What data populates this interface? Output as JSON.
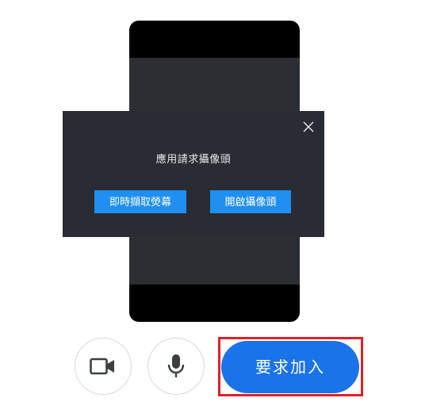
{
  "dialog": {
    "title": "應用請求攝像頭",
    "share_screen_label": "即時擷取熒幕",
    "open_camera_label": "開啟攝像頭",
    "close_icon": "close-icon"
  },
  "controls": {
    "camera_icon": "video-camera-icon",
    "mic_icon": "microphone-icon",
    "join_label": "要求加入"
  },
  "colors": {
    "dialog_bg": "#292c32",
    "dialog_button": "#1f8ff2",
    "join_button": "#1a73e8",
    "highlight_frame": "#e0202a"
  }
}
